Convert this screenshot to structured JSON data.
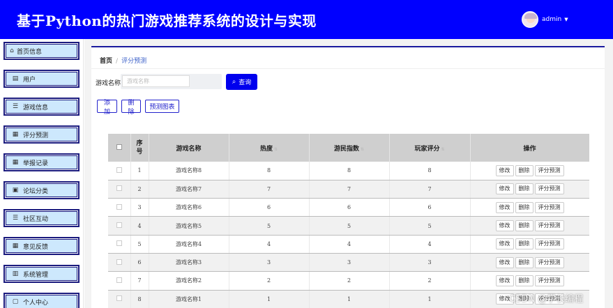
{
  "header": {
    "app_title": "基于Python的热门游戏推荐系统的设计与实现",
    "username": "admin",
    "caret": "▼",
    "bg_color": "#0000ff"
  },
  "sidebar": {
    "items": [
      {
        "label": "首页信息",
        "icon": "home-icon",
        "glyph": "⌂"
      },
      {
        "label": "用户",
        "icon": "clipboard-icon",
        "glyph": "▤"
      },
      {
        "label": "游戏信息",
        "icon": "list-icon",
        "glyph": "☰"
      },
      {
        "label": "评分预测",
        "icon": "grid-icon",
        "glyph": "▦"
      },
      {
        "label": "举报记录",
        "icon": "grid-icon",
        "glyph": "▦"
      },
      {
        "label": "论坛分类",
        "icon": "clipboard-check-icon",
        "glyph": "▣"
      },
      {
        "label": "社区互动",
        "icon": "list-icon",
        "glyph": "☰"
      },
      {
        "label": "意见反馈",
        "icon": "grid-icon",
        "glyph": "▦"
      },
      {
        "label": "系统管理",
        "icon": "bar-chart-icon",
        "glyph": "▥"
      },
      {
        "label": "个人中心",
        "icon": "user-icon",
        "glyph": "▢"
      }
    ]
  },
  "breadcrumb": {
    "home": "首页",
    "separator": "/",
    "current": "评分预测"
  },
  "search": {
    "label": "游戏名称",
    "placeholder": "游戏名称",
    "value": "",
    "button": "查询",
    "button_icon": "⌕"
  },
  "actions": {
    "add": "添加",
    "delete": "删除",
    "chart": "预测图表"
  },
  "table": {
    "headers": {
      "index": "序号",
      "name": "游戏名称",
      "heat": "热度",
      "player_index": "游民指数",
      "rating": "玩家评分",
      "ops": "操作"
    },
    "sort_glyph": "⇅",
    "row_ops": {
      "edit": "修改",
      "delete": "删除",
      "predict": "评分预测"
    },
    "rows": [
      {
        "index": "1",
        "name": "游戏名称8",
        "heat": "8",
        "player_index": "8",
        "rating": "8"
      },
      {
        "index": "2",
        "name": "游戏名称7",
        "heat": "7",
        "player_index": "7",
        "rating": "7"
      },
      {
        "index": "3",
        "name": "游戏名称6",
        "heat": "6",
        "player_index": "6",
        "rating": "6"
      },
      {
        "index": "4",
        "name": "游戏名称5",
        "heat": "5",
        "player_index": "5",
        "rating": "5"
      },
      {
        "index": "5",
        "name": "游戏名称4",
        "heat": "4",
        "player_index": "4",
        "rating": "4"
      },
      {
        "index": "6",
        "name": "游戏名称3",
        "heat": "3",
        "player_index": "3",
        "rating": "3"
      },
      {
        "index": "7",
        "name": "游戏名称2",
        "heat": "2",
        "player_index": "2",
        "rating": "2"
      },
      {
        "index": "8",
        "name": "游戏名称1",
        "heat": "1",
        "player_index": "1",
        "rating": "1"
      }
    ]
  },
  "watermark": "CSDN @学长编程"
}
